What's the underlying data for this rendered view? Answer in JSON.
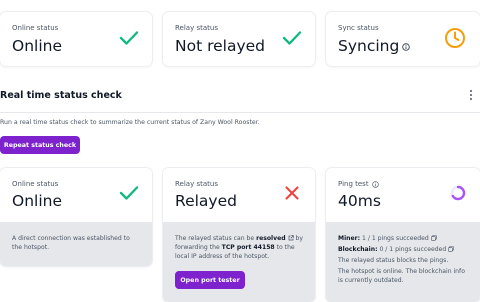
{
  "top_cards": {
    "online": {
      "label": "Online status",
      "value": "Online",
      "icon": "check-icon",
      "icon_color": "#10b981"
    },
    "relay": {
      "label": "Relay status",
      "value": "Not relayed",
      "icon": "check-icon",
      "icon_color": "#10b981"
    },
    "sync": {
      "label": "Sync status",
      "value": "Syncing",
      "icon": "clock-icon",
      "icon_color": "#f59e0b"
    }
  },
  "section": {
    "title": "Real time status check",
    "subtitle": "Run a real time status check to summarize the current status of Zany Wool Rooster.",
    "repeat_button": "Repeat status check"
  },
  "lower_cards": {
    "online": {
      "label": "Online status",
      "value": "Online",
      "icon": "check-icon",
      "icon_color": "#10b981",
      "description_line1": "A direct connection was established to",
      "description_line2": "the hotspot."
    },
    "relay": {
      "label": "Relay status",
      "value": "Relayed",
      "icon": "x-icon",
      "icon_color": "#ef4444",
      "desc_a": "The relayed status can be ",
      "desc_link": "resolved",
      "desc_b": " by",
      "desc_c": "forwarding the ",
      "desc_port": "TCP port 44158",
      "desc_d": " to the",
      "desc_e": "local IP address of the hotspot.",
      "button": "Open port tester"
    },
    "ping": {
      "label": "Ping test",
      "value": "40ms",
      "icon": "spinner-icon",
      "icon_color": "#a855f7",
      "miner_label": "Miner:",
      "miner_value": " 1 / 1 pings succeeded",
      "blockchain_label": "Blockchain:",
      "blockchain_value": " 0 / 1 pings succeeded",
      "note1": "The relayed status blocks the pings.",
      "note2a": "The hotspot is online. The blockchain info",
      "note2b": "is currently outdated."
    }
  },
  "colors": {
    "accent": "#7e22ce",
    "success": "#10b981",
    "error": "#ef4444",
    "warning": "#f59e0b"
  }
}
